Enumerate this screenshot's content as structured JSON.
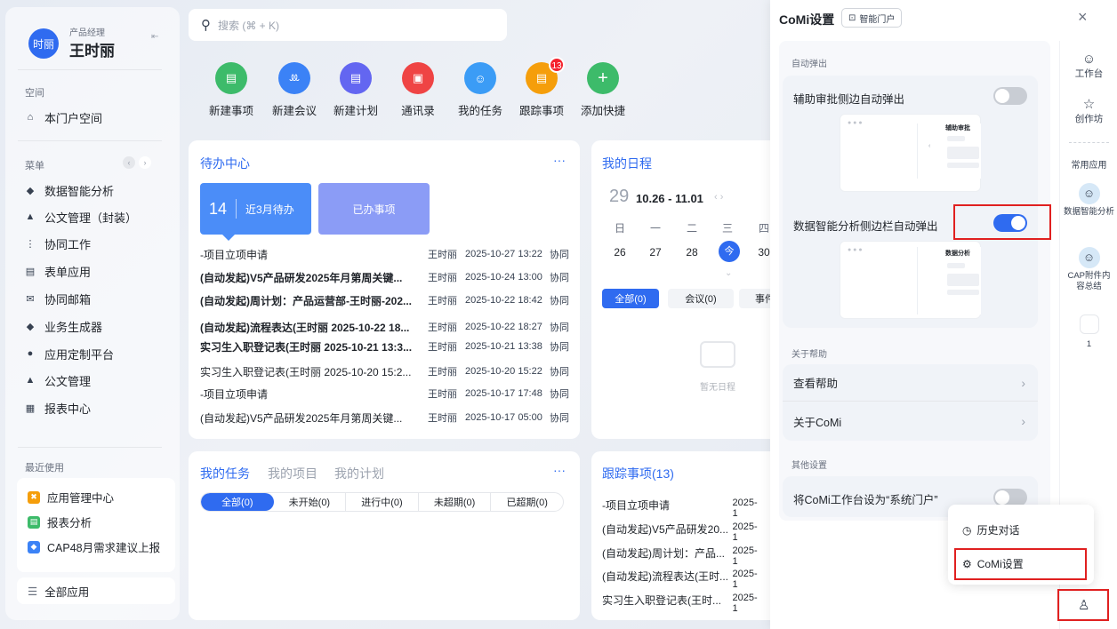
{
  "user": {
    "avatar_text": "时丽",
    "role": "产品经理",
    "name": "王时丽"
  },
  "sidebar": {
    "space_title": "空间",
    "portal_label": "本门户空间",
    "menu_title": "菜单",
    "menu_items": [
      "数据智能分析",
      "公文管理（封装）",
      "协同工作",
      "表单应用",
      "协同邮箱",
      "业务生成器",
      "应用定制平台",
      "公文管理",
      "报表中心"
    ],
    "recent_title": "最近使用",
    "recent_items": [
      "应用管理中心",
      "报表分析",
      "CAP48月需求建议上报"
    ],
    "all_apps_label": "全部应用"
  },
  "search": {
    "placeholder": "搜索 (⌘ + K)"
  },
  "quick_actions": [
    {
      "label": "新建事项",
      "color": "#3dbb6a"
    },
    {
      "label": "新建会议",
      "color": "#3b82f6"
    },
    {
      "label": "新建计划",
      "color": "#6366f1"
    },
    {
      "label": "通讯录",
      "color": "#ef4444"
    },
    {
      "label": "我的任务",
      "color": "#3b9cf6"
    },
    {
      "label": "跟踪事项",
      "color": "#f59e0b",
      "badge": "13"
    },
    {
      "label": "添加快捷",
      "color": "#3dbb6a"
    }
  ],
  "todo": {
    "title": "待办中心",
    "more": "···",
    "tab_count": "14",
    "tab_active": "近3月待办",
    "tab_done": "已办事项",
    "rows": [
      {
        "title": "-项目立项申请",
        "user": "王时丽",
        "date": "2025-10-27 13:22",
        "cat": "协同",
        "bold": false
      },
      {
        "title": "(自动发起)V5产品研发2025年月第周关键...",
        "user": "王时丽",
        "date": "2025-10-24 13:00",
        "cat": "协同",
        "bold": true
      },
      {
        "title": "(自动发起)周计划：产品运营部-王时丽-202...",
        "user": "王时丽",
        "date": "2025-10-22 18:42",
        "cat": "协同",
        "bold": true
      },
      {
        "title": "(自动发起)流程表达(王时丽 2025-10-22 18...",
        "user": "王时丽",
        "date": "2025-10-22 18:27",
        "cat": "协同",
        "bold": true
      },
      {
        "title": "实习生入职登记表(王时丽 2025-10-21 13:3...",
        "user": "王时丽",
        "date": "2025-10-21 13:38",
        "cat": "协同",
        "bold": true
      },
      {
        "title": "实习生入职登记表(王时丽 2025-10-20 15:2...",
        "user": "王时丽",
        "date": "2025-10-20 15:22",
        "cat": "协同",
        "bold": false
      },
      {
        "title": "-项目立项申请",
        "user": "王时丽",
        "date": "2025-10-17 17:48",
        "cat": "协同",
        "bold": false
      },
      {
        "title": "(自动发起)V5产品研发2025年月第周关键...",
        "user": "王时丽",
        "date": "2025-10-17 05:00",
        "cat": "协同",
        "bold": false
      }
    ]
  },
  "schedule": {
    "title": "我的日程",
    "day": "29",
    "range": "10.26 - 11.01",
    "weekdays": [
      "日",
      "一",
      "二",
      "三",
      "四"
    ],
    "dates": [
      "26",
      "27",
      "28",
      "今",
      "30"
    ],
    "tabs": [
      "全部(0)",
      "会议(0)",
      "事件"
    ],
    "empty": "暂无日程"
  },
  "tasks": {
    "tabs": [
      "我的任务",
      "我的项目",
      "我的计划"
    ],
    "more": "···",
    "filters": [
      "全部(0)",
      "未开始(0)",
      "进行中(0)",
      "未超期(0)",
      "已超期(0)"
    ]
  },
  "track": {
    "title": "跟踪事项(13)",
    "rows": [
      {
        "name": "-项目立项申请",
        "date": "2025-1"
      },
      {
        "name": "(自动发起)V5产品研发20...",
        "date": "2025-1"
      },
      {
        "name": "(自动发起)周计划：产品...",
        "date": "2025-1"
      },
      {
        "name": "(自动发起)流程表达(王时...",
        "date": "2025-1"
      },
      {
        "name": "实习生入职登记表(王时...",
        "date": "2025-1"
      }
    ]
  },
  "panel": {
    "title": "CoMi设置",
    "tag": "智能门户",
    "close": "×",
    "sec_auto": "自动弹出",
    "opt1": "辅助审批侧边自动弹出",
    "opt1_on": false,
    "mock1_label": "辅助审批",
    "opt2": "数据智能分析侧边栏自动弹出",
    "opt2_on": true,
    "mock2_label": "数据分析",
    "sec_help": "关于帮助",
    "help1": "查看帮助",
    "help2": "关于CoMi",
    "sec_other": "其他设置",
    "opt3": "将CoMi工作台设为“系统门户”",
    "opt3_on": false
  },
  "rail": {
    "items": [
      "工作台",
      "创作坊"
    ],
    "common_title": "常用应用",
    "apps": [
      "数据智能分析",
      "CAP附件内容总结"
    ],
    "count": "1"
  },
  "popup": {
    "history": "历史对话",
    "settings": "CoMi设置"
  },
  "colors": {
    "accent": "#2f6bf0",
    "toggle_off": "#c9cdd4"
  }
}
